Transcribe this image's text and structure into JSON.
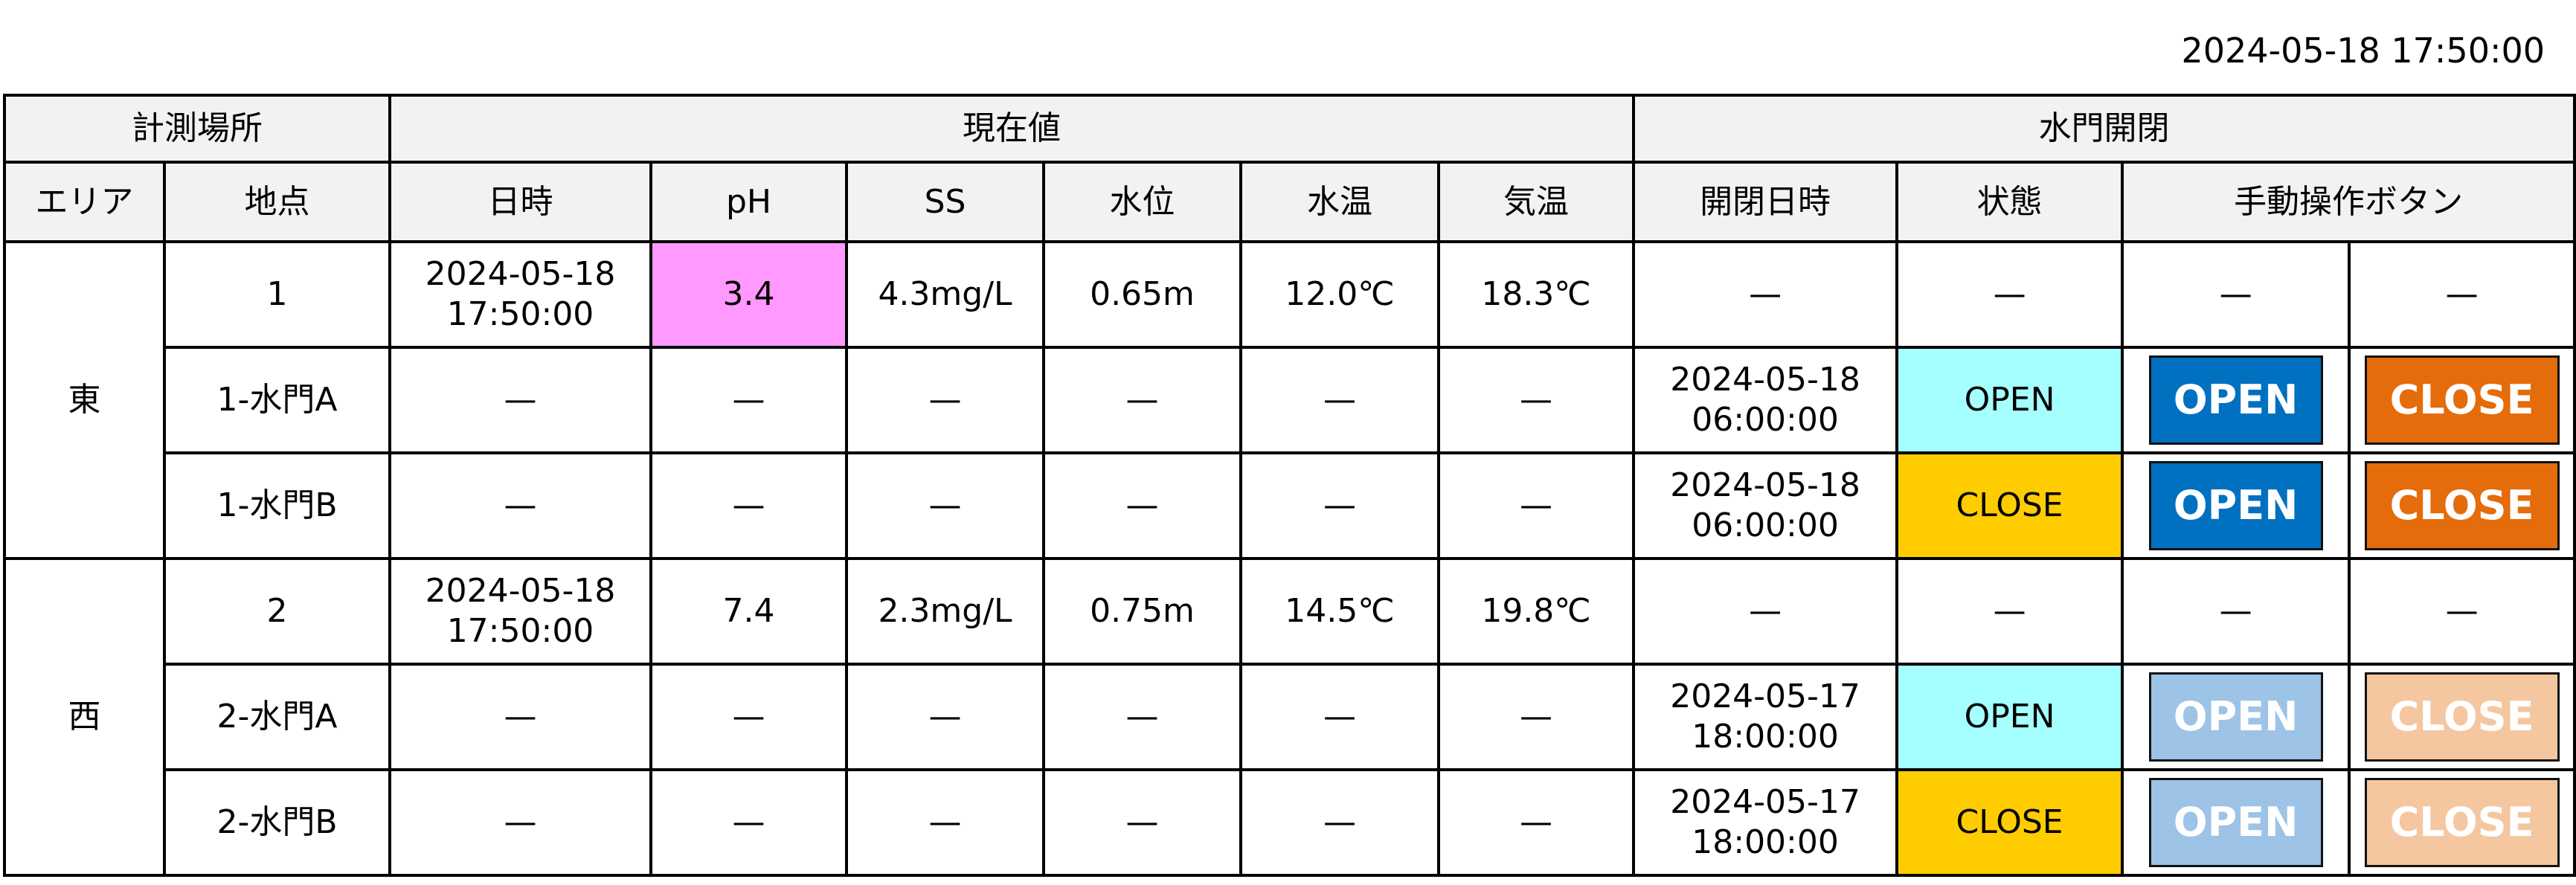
{
  "header": {
    "timestamp": "2024-05-18 17:50:00"
  },
  "table": {
    "group_headers": {
      "location": "計測場所",
      "current_values": "現在値",
      "gate_control": "水門開閉"
    },
    "columns": {
      "area": "エリア",
      "point": "地点",
      "datetime": "日時",
      "ph": "pH",
      "ss": "SS",
      "water_level": "水位",
      "water_temp": "水温",
      "air_temp": "気温",
      "gate_datetime": "開閉日時",
      "state": "状態",
      "manual_buttons": "手動操作ボタン"
    },
    "dash": "—",
    "areas": [
      {
        "name": "東",
        "rows": [
          {
            "point": "1",
            "datetime_date": "2024-05-18",
            "datetime_time": "17:50:00",
            "ph": "3.4",
            "ph_alert": true,
            "ss": "4.3mg/L",
            "water_level": "0.65m",
            "water_temp": "12.0℃",
            "air_temp": "18.3℃",
            "gate_datetime": "—",
            "state": "—",
            "open_button": "—",
            "close_button": "—"
          },
          {
            "point": "1-水門A",
            "datetime": "—",
            "ph": "—",
            "ss": "—",
            "water_level": "—",
            "water_temp": "—",
            "air_temp": "—",
            "gate_date": "2024-05-18",
            "gate_time": "06:00:00",
            "state": "OPEN",
            "open_button": "OPEN",
            "close_button": "CLOSE",
            "buttons_enabled": true
          },
          {
            "point": "1-水門B",
            "datetime": "—",
            "ph": "—",
            "ss": "—",
            "water_level": "—",
            "water_temp": "—",
            "air_temp": "—",
            "gate_date": "2024-05-18",
            "gate_time": "06:00:00",
            "state": "CLOSE",
            "open_button": "OPEN",
            "close_button": "CLOSE",
            "buttons_enabled": true
          }
        ]
      },
      {
        "name": "西",
        "rows": [
          {
            "point": "2",
            "datetime_date": "2024-05-18",
            "datetime_time": "17:50:00",
            "ph": "7.4",
            "ph_alert": false,
            "ss": "2.3mg/L",
            "water_level": "0.75m",
            "water_temp": "14.5℃",
            "air_temp": "19.8℃",
            "gate_datetime": "—",
            "state": "—",
            "open_button": "—",
            "close_button": "—"
          },
          {
            "point": "2-水門A",
            "datetime": "—",
            "ph": "—",
            "ss": "—",
            "water_level": "—",
            "water_temp": "—",
            "air_temp": "—",
            "gate_date": "2024-05-17",
            "gate_time": "18:00:00",
            "state": "OPEN",
            "open_button": "OPEN",
            "close_button": "CLOSE",
            "buttons_enabled": false
          },
          {
            "point": "2-水門B",
            "datetime": "—",
            "ph": "—",
            "ss": "—",
            "water_level": "—",
            "water_temp": "—",
            "air_temp": "—",
            "gate_date": "2024-05-17",
            "gate_time": "18:00:00",
            "state": "CLOSE",
            "open_button": "OPEN",
            "close_button": "CLOSE",
            "buttons_enabled": false
          }
        ]
      }
    ]
  },
  "colors": {
    "header_bg": "#F2F2F2",
    "ph_alert_bg": "#FF99FF",
    "state_open_bg": "#A5FFFF",
    "state_close_bg": "#FFCC00",
    "open_button_bg": "#0070C0",
    "close_button_bg": "#E46C0A",
    "open_button_disabled_bg": "#9DC3E6",
    "close_button_disabled_bg": "#F4C7A0"
  }
}
